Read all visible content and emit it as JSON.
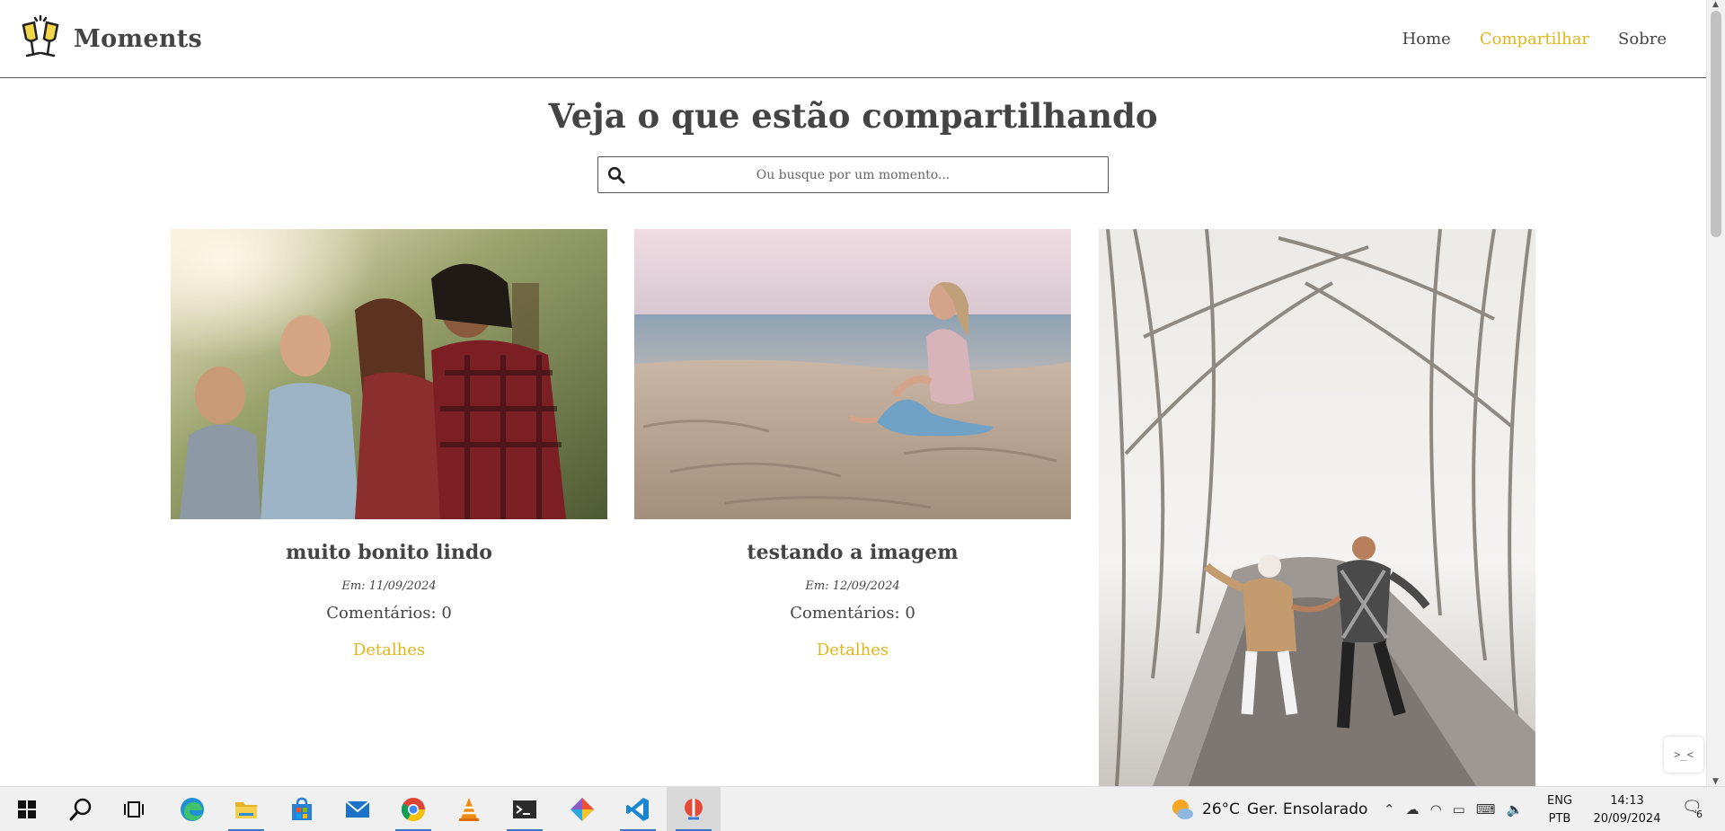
{
  "header": {
    "brand": "Moments",
    "nav": [
      {
        "label": "Home",
        "active": false
      },
      {
        "label": "Compartilhar",
        "active": true
      },
      {
        "label": "Sobre",
        "active": false
      }
    ]
  },
  "main": {
    "title": "Veja o que estão compartilhando",
    "search_placeholder": "Ou busque por um momento...",
    "cards": [
      {
        "title": "muito bonito lindo",
        "date": "Em: 11/09/2024",
        "comments": "Comentários: 0",
        "details": "Detalhes"
      },
      {
        "title": "testando a imagem",
        "date": "Em: 12/09/2024",
        "comments": "Comentários: 0",
        "details": "Detalhes"
      }
    ]
  },
  "colors": {
    "accent": "#e0b61a",
    "text": "#444444"
  },
  "taskbar": {
    "weather": {
      "temp": "26°C",
      "condition": "Ger. Ensolarado"
    },
    "lang": {
      "line1": "ENG",
      "line2": "PTB"
    },
    "clock": {
      "time": "14:13",
      "date": "20/09/2024"
    },
    "notifications": "6",
    "apps": [
      "start-icon",
      "search-icon",
      "task-view-icon",
      "edge-icon",
      "file-explorer-icon",
      "store-icon",
      "mail-icon",
      "chrome-icon",
      "vlc-icon",
      "terminal-icon",
      "git-icon",
      "vscode-icon",
      "app-icon"
    ]
  }
}
